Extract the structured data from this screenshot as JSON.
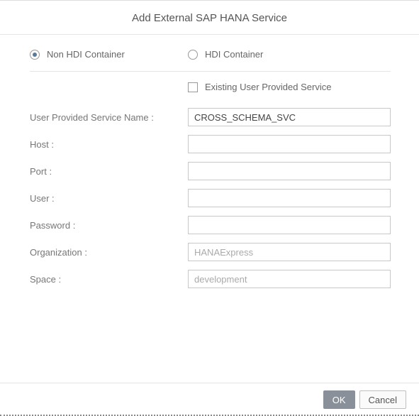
{
  "title": "Add External SAP HANA Service",
  "containerType": {
    "nonHdi": {
      "label": "Non HDI Container",
      "selected": true
    },
    "hdi": {
      "label": "HDI Container",
      "selected": false
    }
  },
  "existingService": {
    "label": "Existing User Provided Service",
    "checked": false
  },
  "fields": {
    "serviceName": {
      "label": "User Provided Service Name :",
      "value": "CROSS_SCHEMA_SVC"
    },
    "host": {
      "label": "Host :",
      "value": ""
    },
    "port": {
      "label": "Port :",
      "value": ""
    },
    "user": {
      "label": "User :",
      "value": ""
    },
    "password": {
      "label": "Password :",
      "value": ""
    },
    "organization": {
      "label": "Organization :",
      "value": "HANAExpress"
    },
    "space": {
      "label": "Space :",
      "value": "development"
    }
  },
  "buttons": {
    "ok": "OK",
    "cancel": "Cancel"
  }
}
